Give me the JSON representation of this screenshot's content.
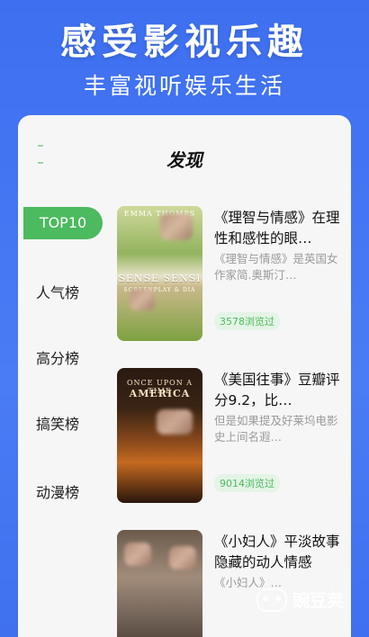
{
  "banner": {
    "headline": "感受影视乐趣",
    "subline": "丰富视听娱乐生活"
  },
  "page": {
    "title": "发现"
  },
  "sidebar": {
    "items": [
      {
        "label": "TOP10",
        "active": true
      },
      {
        "label": "人气榜",
        "active": false
      },
      {
        "label": "高分榜",
        "active": false
      },
      {
        "label": "搞笑榜",
        "active": false
      },
      {
        "label": "动漫榜",
        "active": false
      }
    ]
  },
  "cards": [
    {
      "title": "《理智与情感》在理性和感性的眼…",
      "desc": "《理智与情感》是英国女作家简.奥斯汀…",
      "views": "3578浏览过",
      "poster_top": "EMMA THOMPS",
      "poster_main": "SENSE SENSI",
      "poster_sub": "SCREENPLAY & DIA"
    },
    {
      "title": "《美国往事》豆瓣评分9.2，比…",
      "desc": "但是如果提及好莱坞电影史上间名遐…",
      "views": "9014浏览过",
      "poster_top": "ONCE UPON A TIME",
      "poster_main": "AMERICA",
      "poster_sub": ""
    },
    {
      "title": "《小妇人》平淡故事隐藏的动人情感",
      "desc": "《小妇人》…",
      "views": "",
      "poster_top": "",
      "poster_main": "",
      "poster_sub": ""
    }
  ],
  "watermark": {
    "text": "豌豆荚"
  },
  "colors": {
    "background": "#3d6ff0",
    "accent_green": "#4cba5e",
    "panel": "#f6f6f6"
  }
}
